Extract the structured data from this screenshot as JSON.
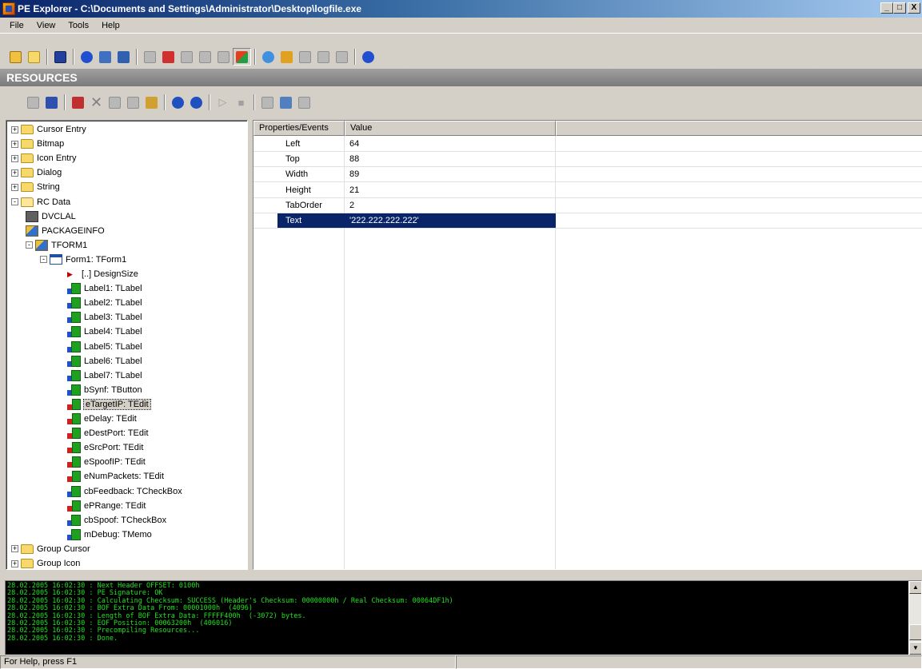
{
  "window": {
    "title": "PE Explorer - C:\\Documents and Settings\\Administrator\\Desktop\\logfile.exe",
    "minimize": "_",
    "maximize": "□",
    "close": "X"
  },
  "menu": [
    "File",
    "View",
    "Tools",
    "Help"
  ],
  "section_title": "RESOURCES",
  "tree": [
    {
      "label": "Cursor Entry",
      "level": 0,
      "toggle": "+",
      "icon": "folder-icon"
    },
    {
      "label": "Bitmap",
      "level": 0,
      "toggle": "+",
      "icon": "folder-icon"
    },
    {
      "label": "Icon Entry",
      "level": 0,
      "toggle": "+",
      "icon": "folder-icon"
    },
    {
      "label": "Dialog",
      "level": 0,
      "toggle": "+",
      "icon": "folder-icon"
    },
    {
      "label": "String",
      "level": 0,
      "toggle": "+",
      "icon": "folder-icon"
    },
    {
      "label": "RC Data",
      "level": 0,
      "toggle": "-",
      "icon": "folder-open-icon"
    },
    {
      "label": "DVCLAL",
      "level": 1,
      "toggle": "",
      "icon": "dvclal-icon"
    },
    {
      "label": "PACKAGEINFO",
      "level": 1,
      "toggle": "",
      "icon": "packageinfo-icon"
    },
    {
      "label": "TFORM1",
      "level": 1,
      "toggle": "-",
      "icon": "packageinfo-icon"
    },
    {
      "label": "Form1: TForm1",
      "level": 2,
      "toggle": "-",
      "icon": "form-icon"
    },
    {
      "label": "[..] DesignSize",
      "level": 3,
      "toggle": "",
      "icon": "arrow-icon"
    },
    {
      "label": "Label1: TLabel",
      "level": 3,
      "toggle": "",
      "icon": "component-icon"
    },
    {
      "label": "Label2: TLabel",
      "level": 3,
      "toggle": "",
      "icon": "component-icon"
    },
    {
      "label": "Label3: TLabel",
      "level": 3,
      "toggle": "",
      "icon": "component-icon"
    },
    {
      "label": "Label4: TLabel",
      "level": 3,
      "toggle": "",
      "icon": "component-icon"
    },
    {
      "label": "Label5: TLabel",
      "level": 3,
      "toggle": "",
      "icon": "component-icon"
    },
    {
      "label": "Label6: TLabel",
      "level": 3,
      "toggle": "",
      "icon": "component-icon"
    },
    {
      "label": "Label7: TLabel",
      "level": 3,
      "toggle": "",
      "icon": "component-icon"
    },
    {
      "label": "bSynf: TButton",
      "level": 3,
      "toggle": "",
      "icon": "component-icon"
    },
    {
      "label": "eTargetIP: TEdit",
      "level": 3,
      "toggle": "",
      "icon": "component-red-icon",
      "selected": true
    },
    {
      "label": "eDelay: TEdit",
      "level": 3,
      "toggle": "",
      "icon": "component-red-icon"
    },
    {
      "label": "eDestPort: TEdit",
      "level": 3,
      "toggle": "",
      "icon": "component-red-icon"
    },
    {
      "label": "eSrcPort: TEdit",
      "level": 3,
      "toggle": "",
      "icon": "component-red-icon"
    },
    {
      "label": "eSpoofIP: TEdit",
      "level": 3,
      "toggle": "",
      "icon": "component-red-icon"
    },
    {
      "label": "eNumPackets: TEdit",
      "level": 3,
      "toggle": "",
      "icon": "component-red-icon"
    },
    {
      "label": "cbFeedback: TCheckBox",
      "level": 3,
      "toggle": "",
      "icon": "component-icon"
    },
    {
      "label": "ePRange: TEdit",
      "level": 3,
      "toggle": "",
      "icon": "component-red-icon"
    },
    {
      "label": "cbSpoof: TCheckBox",
      "level": 3,
      "toggle": "",
      "icon": "component-icon"
    },
    {
      "label": "mDebug: TMemo",
      "level": 3,
      "toggle": "",
      "icon": "component-icon"
    },
    {
      "label": "Group Cursor",
      "level": 0,
      "toggle": "+",
      "icon": "folder-icon"
    },
    {
      "label": "Group Icon",
      "level": 0,
      "toggle": "+",
      "icon": "folder-icon"
    }
  ],
  "properties": {
    "headers": [
      "Properties/Events",
      "Value"
    ],
    "rows": [
      {
        "name": "Left",
        "value": "64"
      },
      {
        "name": "Top",
        "value": "88"
      },
      {
        "name": "Width",
        "value": "89"
      },
      {
        "name": "Height",
        "value": "21"
      },
      {
        "name": "TabOrder",
        "value": "2"
      },
      {
        "name": "Text",
        "value": "'222.222.222.222'",
        "selected": true
      }
    ]
  },
  "log": [
    "28.02.2005 16:02:30 : Next Header OFFSET: 0100h",
    "28.02.2005 16:02:30 : PE Signature: OK",
    "28.02.2005 16:02:30 : Calculating Checksum: SUCCESS (Header's Checksum: 00000000h / Real Checksum: 00064DF1h)",
    "28.02.2005 16:02:30 : BOF Extra Data From: 00001000h  (4096)",
    "28.02.2005 16:02:30 : Length of BOF Extra Data: FFFFF400h  (-3072) bytes.",
    "28.02.2005 16:02:30 : EOF Position: 00063200h  (406016)",
    "28.02.2005 16:02:30 : Precompiling Resources...",
    "28.02.2005 16:02:30 : Done."
  ],
  "status": "For Help, press F1",
  "colors": {
    "selection": "#0a246a",
    "log_text": "#20e020",
    "title_start": "#0a246a"
  }
}
